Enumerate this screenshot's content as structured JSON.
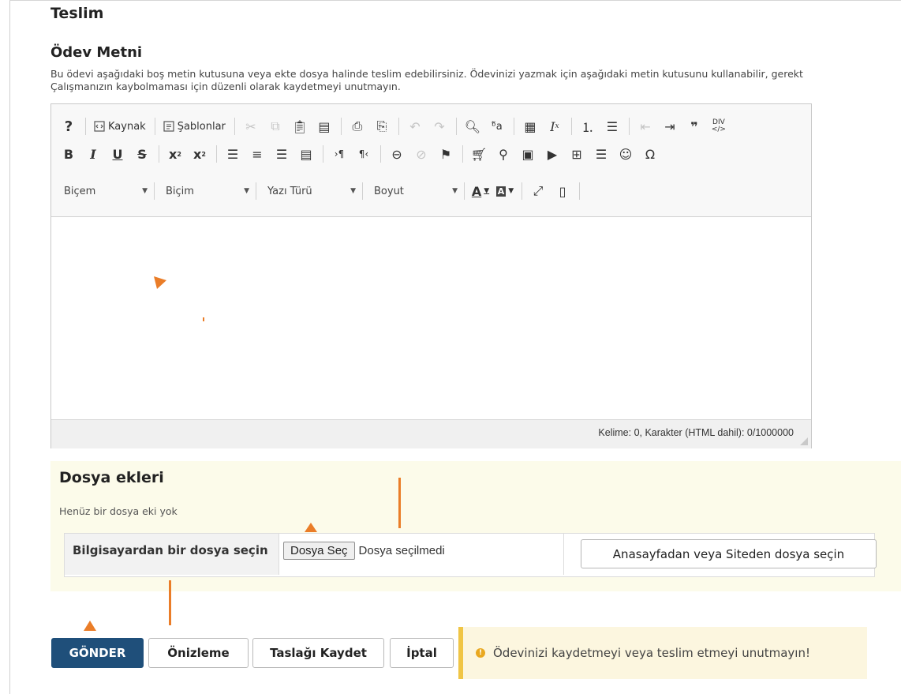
{
  "section_title": "Teslim",
  "assignment_text": {
    "title": "Ödev Metni",
    "description_line1": "Bu ödevi aşağıdaki boş metin kutusuna veya ekte dosya halinde teslim edebilirsiniz. Ödevinizi yazmak için aşağıdaki metin kutusunu kullanabilir, gerekt",
    "description_line2": "Çalışmanızın kaybolmaması için düzenli olarak kaydetmeyi unutmayın."
  },
  "editor": {
    "toolbar": {
      "source_label": "Kaynak",
      "templates_label": "Şablonlar",
      "combos": {
        "style": "Biçem",
        "format": "Biçim",
        "font": "Yazı Türü",
        "size": "Boyut"
      },
      "help_glyph": "?"
    },
    "word_count": "Kelime: 0, Karakter (HTML dahil): 0/1000000"
  },
  "attachments": {
    "title": "Dosya ekleri",
    "empty_text": "Henüz bir dosya eki yok",
    "computer_label": "Bilgisayardan bir dosya seçin",
    "choose_button": "Dosya Seç",
    "no_file_text": "Dosya seçilmedi",
    "site_button": "Anasayfadan veya Siteden dosya seçin"
  },
  "actions": {
    "submit": "GÖNDER",
    "preview": "Önizleme",
    "save_draft": "Taslağı Kaydet",
    "cancel": "İptal"
  },
  "notice": {
    "text": "Ödevinizi kaydetmeyi veya teslim etmeyi unutmayın!"
  },
  "colors": {
    "primary_button": "#1f4f7a",
    "notice_border": "#f0c545",
    "attachments_bg": "#fcfbea",
    "annotation": "#ea7d28"
  }
}
